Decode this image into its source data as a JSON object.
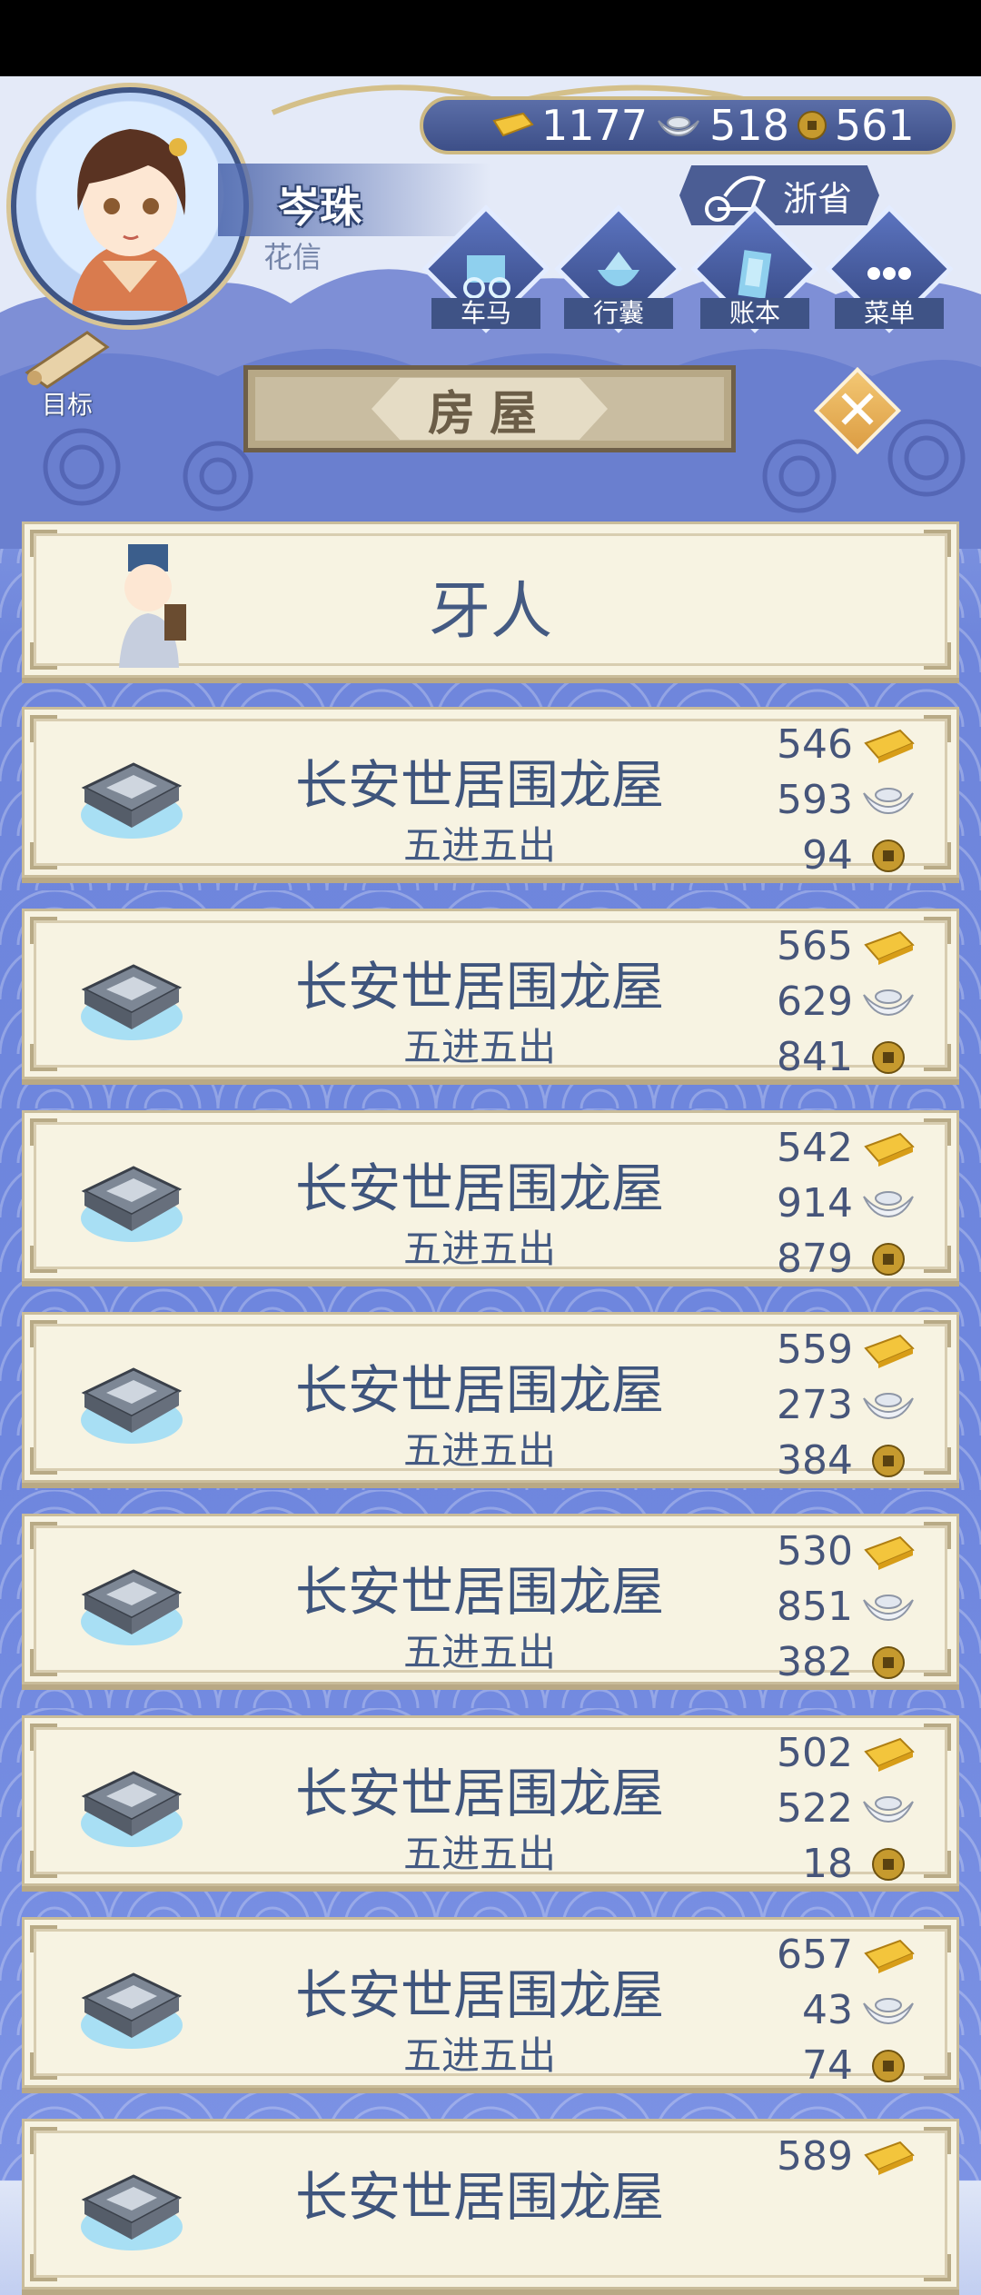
{
  "player": {
    "name": "岑珠",
    "title": "花信"
  },
  "currency": {
    "gold": "1177",
    "silver": "518",
    "copper": "561"
  },
  "region": "浙省",
  "menu": [
    {
      "label": "车马",
      "icon": "carriage-icon"
    },
    {
      "label": "行囊",
      "icon": "bundle-icon"
    },
    {
      "label": "账本",
      "icon": "ledger-icon"
    },
    {
      "label": "菜单",
      "icon": "more-icon"
    }
  ],
  "goal_label": "目标",
  "page_title": "房屋",
  "agent_label": "牙人",
  "houses": [
    {
      "name": "长安世居围龙屋",
      "sub": "五进五出",
      "gold": "546",
      "silver": "593",
      "copper": "94"
    },
    {
      "name": "长安世居围龙屋",
      "sub": "五进五出",
      "gold": "565",
      "silver": "629",
      "copper": "841"
    },
    {
      "name": "长安世居围龙屋",
      "sub": "五进五出",
      "gold": "542",
      "silver": "914",
      "copper": "879"
    },
    {
      "name": "长安世居围龙屋",
      "sub": "五进五出",
      "gold": "559",
      "silver": "273",
      "copper": "384"
    },
    {
      "name": "长安世居围龙屋",
      "sub": "五进五出",
      "gold": "530",
      "silver": "851",
      "copper": "382"
    },
    {
      "name": "长安世居围龙屋",
      "sub": "五进五出",
      "gold": "502",
      "silver": "522",
      "copper": "18"
    },
    {
      "name": "长安世居围龙屋",
      "sub": "五进五出",
      "gold": "657",
      "silver": "43",
      "copper": "74"
    },
    {
      "name": "长安世居围龙屋",
      "sub": "",
      "gold": "589",
      "silver": "",
      "copper": ""
    }
  ],
  "colors": {
    "accent_blue": "#445a82",
    "gold": "#e9b12c",
    "card_bg": "#f7f3e2",
    "close_button": "#e6a94f"
  }
}
